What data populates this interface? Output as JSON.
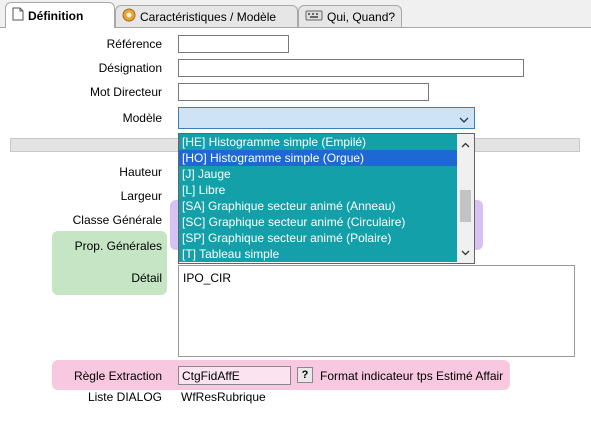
{
  "tabs": [
    {
      "label": "Définition",
      "icon": "document-icon"
    },
    {
      "label": "Caractéristiques / Modèle",
      "icon": "gear-icon"
    },
    {
      "label": "Qui, Quand?",
      "icon": "keyboard-icon"
    }
  ],
  "form": {
    "reference_label": "Référence",
    "reference_value": "",
    "designation_label": "Désignation",
    "designation_value": "",
    "mot_directeur_label": "Mot Directeur",
    "mot_directeur_value": "",
    "modele_label": "Modèle",
    "modele_value": "",
    "hauteur_label": "Hauteur",
    "largeur_label": "Largeur",
    "classe_label": "Classe Générale",
    "prop_label": "Prop. Générales",
    "detail_label": "Détail",
    "detail_value": "IPO_CIR",
    "regle_label": "Règle Extraction",
    "regle_value": "CtgFidAffE",
    "regle_help": "?",
    "regle_desc": "Format indicateur tps Estimé Affair",
    "liste_label": "Liste DIALOG",
    "liste_value": "WfResRubrique"
  },
  "modele_options": [
    {
      "label": "[HE] Histogramme simple (Empilé)",
      "selected": false
    },
    {
      "label": "[HO] Histogramme simple (Orgue)",
      "selected": true
    },
    {
      "label": "[J] Jauge",
      "selected": false
    },
    {
      "label": "[L] Libre",
      "selected": false
    },
    {
      "label": "[SA] Graphique secteur animé (Anneau)",
      "selected": false
    },
    {
      "label": "[SC] Graphique secteur animé (Circulaire)",
      "selected": false
    },
    {
      "label": "[SP] Graphique secteur animé (Polaire)",
      "selected": false
    },
    {
      "label": "[T] Tableau simple",
      "selected": false
    }
  ]
}
